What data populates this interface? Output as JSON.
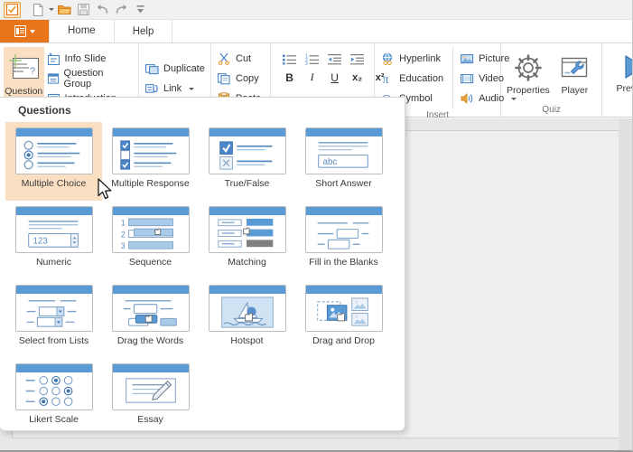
{
  "quick_access": {
    "items": [
      {
        "name": "app-icon",
        "icon": "checkbox-orange-icon"
      },
      {
        "name": "new",
        "icon": "new-document-icon",
        "has_caret": true
      },
      {
        "name": "open",
        "icon": "open-folder-icon"
      },
      {
        "name": "save",
        "icon": "save-disk-icon"
      },
      {
        "name": "undo",
        "icon": "undo-arrow-icon"
      },
      {
        "name": "redo",
        "icon": "redo-arrow-icon"
      },
      {
        "name": "customize",
        "icon": "customize-toolbar-icon"
      }
    ]
  },
  "tabs": {
    "file_menu_label": "",
    "items": [
      {
        "label": "Home",
        "selected": true
      },
      {
        "label": "Help",
        "selected": false
      }
    ]
  },
  "ribbon": {
    "groups": [
      {
        "label": "",
        "big_button": {
          "label": "Question",
          "icon": "question-slide-icon",
          "has_caret": true
        },
        "small_buttons": [
          {
            "label": "Info Slide",
            "icon": "info-slide-icon",
            "has_caret": false
          },
          {
            "label": "Question Group",
            "icon": "question-group-icon",
            "has_caret": false
          },
          {
            "label": "Introduction",
            "icon": "introduction-icon",
            "has_caret": true
          }
        ]
      },
      {
        "label": "",
        "small_buttons": [
          {
            "label": "Duplicate",
            "icon": "duplicate-icon",
            "has_caret": false
          },
          {
            "label": "Link",
            "icon": "link-icon",
            "has_caret": true
          }
        ]
      },
      {
        "label": "",
        "small_buttons": [
          {
            "label": "Cut",
            "icon": "scissors-icon",
            "has_caret": false
          },
          {
            "label": "Copy",
            "icon": "copy-icon",
            "has_caret": false
          },
          {
            "label": "Paste",
            "icon": "clipboard-icon",
            "has_caret": false
          }
        ]
      },
      {
        "label": "",
        "format_icons": [
          {
            "name": "bulleted-list-icon"
          },
          {
            "name": "numbered-list-icon"
          },
          {
            "name": "decrease-indent-icon"
          },
          {
            "name": "increase-indent-icon"
          }
        ],
        "format_text": [
          {
            "name": "bold-button",
            "glyph": "B"
          },
          {
            "name": "italic-button",
            "glyph": "I"
          },
          {
            "name": "underline-button",
            "glyph": "U"
          },
          {
            "name": "subscript-button",
            "glyph": "x₂"
          },
          {
            "name": "superscript-button",
            "glyph": "x²"
          }
        ]
      },
      {
        "label": "Insert",
        "column_a": [
          {
            "label": "Hyperlink",
            "icon": "hyperlink-globe-icon",
            "has_caret": false
          },
          {
            "label": "Education",
            "icon": "education-pi-icon",
            "has_caret": false
          },
          {
            "label": "Symbol",
            "icon": "symbol-omega-icon",
            "has_caret": false
          }
        ],
        "column_b": [
          {
            "label": "Picture",
            "icon": "picture-icon",
            "has_caret": false
          },
          {
            "label": "Video",
            "icon": "video-icon",
            "has_caret": false
          },
          {
            "label": "Audio",
            "icon": "audio-speaker-icon",
            "has_caret": true
          }
        ]
      },
      {
        "label": "Quiz",
        "big_buttons": [
          {
            "label": "Properties",
            "icon": "gear-icon",
            "has_caret": false
          },
          {
            "label": "Player",
            "icon": "player-window-wrench-icon",
            "has_caret": false
          }
        ]
      },
      {
        "label": "",
        "big_buttons": [
          {
            "label": "Preview",
            "icon": "play-triangle-icon",
            "has_caret": true
          }
        ]
      }
    ],
    "overflow_caret": "ribbon-overflow-caret"
  },
  "gallery": {
    "title": "Questions",
    "tiles": [
      {
        "label": "Multiple Choice",
        "thumb": "radio-list-thumb",
        "selected": true
      },
      {
        "label": "Multiple Response",
        "thumb": "checkbox-list-thumb",
        "selected": false
      },
      {
        "label": "True/False",
        "thumb": "true-false-thumb",
        "selected": false
      },
      {
        "label": "Short Answer",
        "thumb": "short-answer-thumb",
        "selected": false
      },
      {
        "label": "Numeric",
        "thumb": "numeric-spinner-thumb",
        "selected": false
      },
      {
        "label": "Sequence",
        "thumb": "sequence-thumb",
        "selected": false
      },
      {
        "label": "Matching",
        "thumb": "matching-thumb",
        "selected": false
      },
      {
        "label": "Fill in the Blanks",
        "thumb": "fill-blanks-thumb",
        "selected": false
      },
      {
        "label": "Select from Lists",
        "thumb": "select-lists-thumb",
        "selected": false
      },
      {
        "label": "Drag the Words",
        "thumb": "drag-words-thumb",
        "selected": false
      },
      {
        "label": "Hotspot",
        "thumb": "hotspot-boat-thumb",
        "selected": false
      },
      {
        "label": "Drag and Drop",
        "thumb": "drag-drop-thumb",
        "selected": false
      },
      {
        "label": "Likert Scale",
        "thumb": "likert-grid-thumb",
        "selected": false
      },
      {
        "label": "Essay",
        "thumb": "essay-pencil-thumb",
        "selected": false
      }
    ],
    "numeric_value": "123",
    "short_answer_value": "abc",
    "sequence_numbers": [
      "1",
      "2",
      "3"
    ]
  },
  "colors": {
    "accent_orange": "#e8751a",
    "highlight_peach": "#fbdfc3",
    "thumb_blue": "#5b9bd5",
    "icon_blue": "#4a86c8",
    "workspace_gray": "#e8e8e8"
  }
}
